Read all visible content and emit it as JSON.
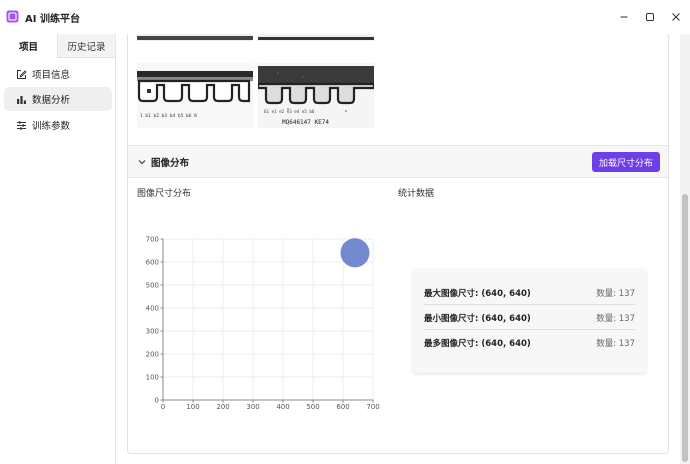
{
  "window": {
    "title": "AI 训练平台"
  },
  "sidebar": {
    "tabs": [
      {
        "label": "项目"
      },
      {
        "label": "历史记录"
      }
    ],
    "items": [
      {
        "label": "项目信息",
        "icon": "edit-icon"
      },
      {
        "label": "数据分析",
        "icon": "chart-bar-icon"
      },
      {
        "label": "训练参数",
        "icon": "sliders-icon"
      }
    ]
  },
  "preview": {
    "top_text": "1  b1  b2  b3  b4  b5  b6  8",
    "bottom_text": "MQ646147 KE74",
    "bottom_numbers": "61  e1  e2  e3  e4  e5  b6"
  },
  "section": {
    "title": "图像分布",
    "load_button": "加载尺寸分布"
  },
  "size_distribution": {
    "label": "图像尺寸分布"
  },
  "stats": {
    "label": "统计数据",
    "rows": [
      {
        "label": "最大图像尺寸: (640, 640)",
        "count": "数量: 137"
      },
      {
        "label": "最小图像尺寸: (640, 640)",
        "count": "数量: 137"
      },
      {
        "label": "最多图像尺寸: (640, 640)",
        "count": "数量: 137"
      }
    ]
  },
  "colors": {
    "accent": "#6e3ee6",
    "bubble": "#5b74c8"
  },
  "chart_data": {
    "type": "scatter",
    "x": [
      640
    ],
    "y": [
      640
    ],
    "sizes": [
      137
    ],
    "xlim": [
      0,
      700
    ],
    "ylim": [
      0,
      700
    ],
    "xticks": [
      "0",
      "100",
      "200",
      "300",
      "400",
      "500",
      "600",
      "700"
    ],
    "yticks": [
      "0",
      "100",
      "200",
      "300",
      "400",
      "500",
      "600",
      "700"
    ],
    "grid": true,
    "title": "",
    "xlabel": "",
    "ylabel": ""
  }
}
